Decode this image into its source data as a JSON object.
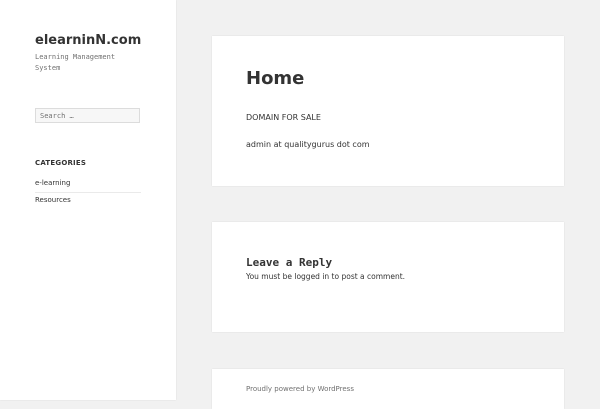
{
  "site": {
    "title": "elearninN.com",
    "description": "Learning Management System"
  },
  "search": {
    "placeholder": "Search …"
  },
  "categories": {
    "heading": "CATEGORIES",
    "items": [
      {
        "label": "e-learning"
      },
      {
        "label": "Resources"
      }
    ]
  },
  "post": {
    "title": "Home",
    "lines": [
      "DOMAIN FOR SALE",
      "admin at qualitygurus dot com"
    ]
  },
  "comments": {
    "title": "Leave a Reply",
    "note_prefix": "You must be ",
    "login_link": "logged in",
    "note_suffix": " to post a comment."
  },
  "footer": {
    "credit": "Proudly powered by WordPress"
  }
}
